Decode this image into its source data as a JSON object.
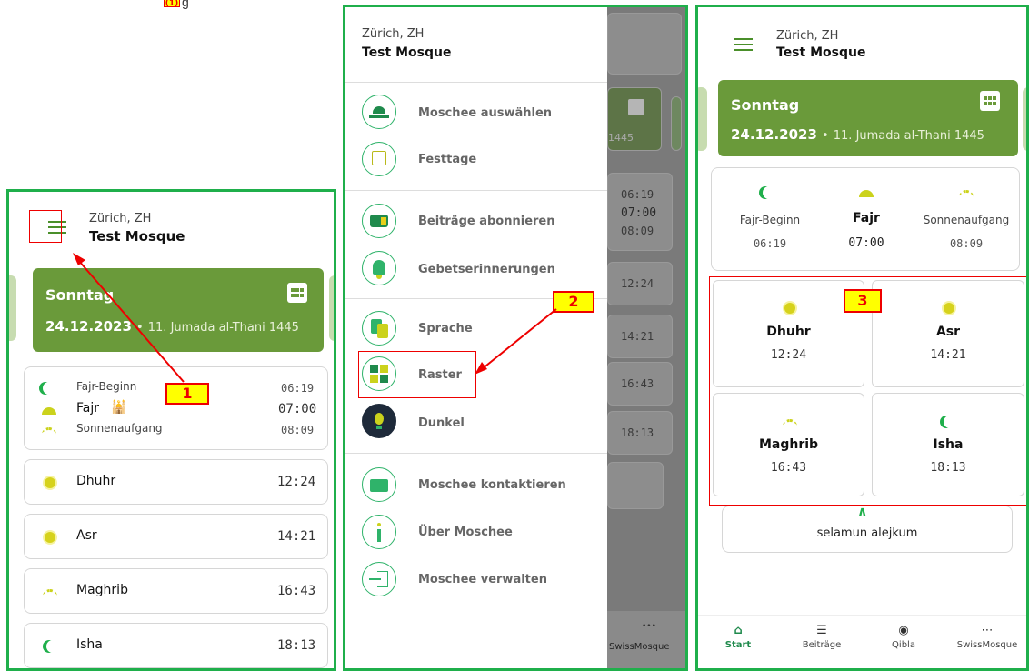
{
  "top_fragment": {
    "step_label": "(1)",
    "text": "g"
  },
  "panel1": {
    "city": "Zürich, ZH",
    "mosque": "Test Mosque",
    "card": {
      "day": "Sonntag",
      "date": "24.12.2023",
      "sep": "•",
      "hijri": "11. Jumada al-Thani 1445"
    },
    "fajr_block": [
      {
        "label": "Fajr-Beginn",
        "time": "06:19"
      },
      {
        "label": "Fajr",
        "time": "07:00"
      },
      {
        "label": "Sonnenaufgang",
        "time": "08:09"
      }
    ],
    "prayers": [
      {
        "label": "Dhuhr",
        "time": "12:24"
      },
      {
        "label": "Asr",
        "time": "14:21"
      },
      {
        "label": "Maghrib",
        "time": "16:43"
      },
      {
        "label": "Isha",
        "time": "18:13"
      }
    ],
    "callout": "1"
  },
  "panel2": {
    "city": "Zürich, ZH",
    "mosque": "Test Mosque",
    "menu": [
      {
        "label": "Moschee auswählen"
      },
      {
        "label": "Festtage"
      },
      {
        "label": "Beiträge abonnieren"
      },
      {
        "label": "Gebetserinnerungen"
      },
      {
        "label": "Sprache"
      },
      {
        "label": "Raster"
      },
      {
        "label": "Dunkel"
      },
      {
        "label": "Moschee kontaktieren"
      },
      {
        "label": "Über Moschee"
      },
      {
        "label": "Moschee verwalten"
      }
    ],
    "bg_fragment": "1445",
    "bg_times": [
      "06:19",
      "07:00",
      "08:09",
      "12:24",
      "14:21",
      "16:43",
      "18:13"
    ],
    "bg_nav": {
      "dots": "•••",
      "label": "SwissMosque"
    },
    "callout": "2"
  },
  "panel3": {
    "city": "Zürich, ZH",
    "mosque": "Test Mosque",
    "card": {
      "day": "Sonntag",
      "date": "24.12.2023",
      "sep": "•",
      "hijri": "11. Jumada al-Thani 1445"
    },
    "top_three": [
      {
        "label": "Fajr-Beginn",
        "time": "06:19"
      },
      {
        "label": "Fajr",
        "time": "07:00"
      },
      {
        "label": "Sonnenaufgang",
        "time": "08:09"
      }
    ],
    "grid": [
      {
        "label": "Dhuhr",
        "time": "12:24"
      },
      {
        "label": "Asr",
        "time": "14:21"
      },
      {
        "label": "Maghrib",
        "time": "16:43"
      },
      {
        "label": "Isha",
        "time": "18:13"
      }
    ],
    "message": "selamun alejkum",
    "nav": [
      {
        "label": "Start",
        "icon": "home-icon"
      },
      {
        "label": "Beiträge",
        "icon": "document-icon"
      },
      {
        "label": "Qibla",
        "icon": "compass-icon"
      },
      {
        "label": "SwissMosque",
        "icon": "more-icon"
      }
    ],
    "callout": "3"
  },
  "colors": {
    "accent": "#1faf4b",
    "card": "#6a9a3a",
    "callout_fill": "#ffff00",
    "callout_border": "#e00000"
  }
}
